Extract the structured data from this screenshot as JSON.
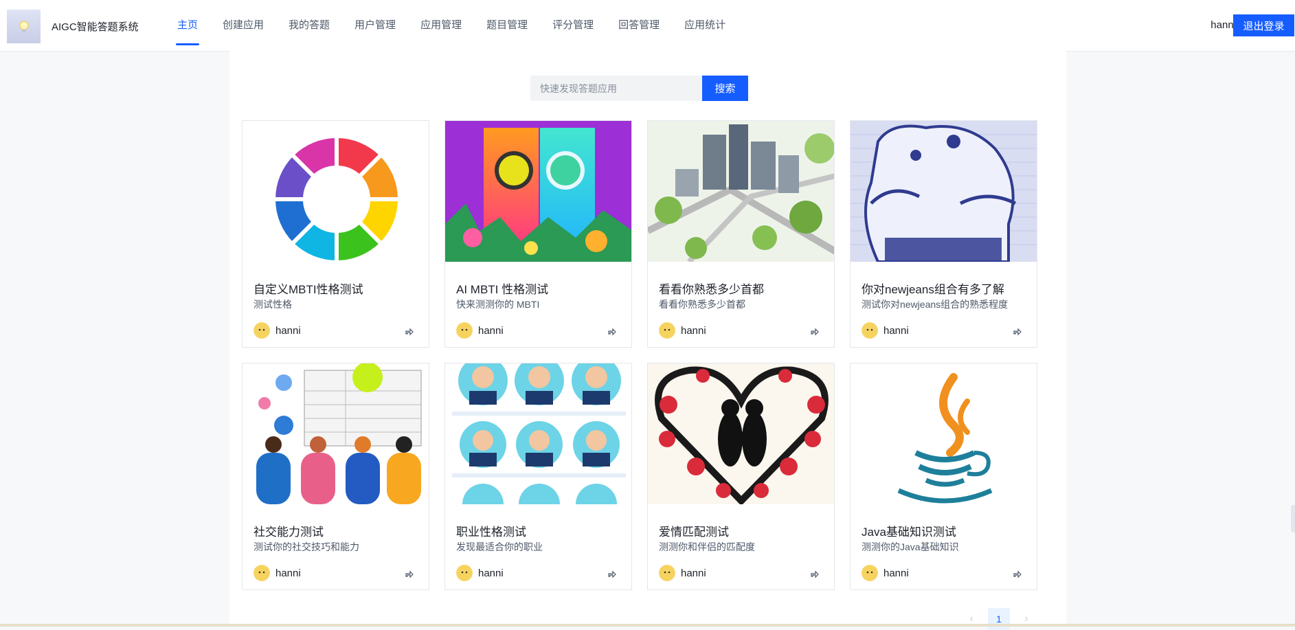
{
  "header": {
    "brand_title": "AIGC智能答题系统",
    "nav": [
      {
        "label": "主页",
        "active": true
      },
      {
        "label": "创建应用",
        "active": false
      },
      {
        "label": "我的答题",
        "active": false
      },
      {
        "label": "用户管理",
        "active": false
      },
      {
        "label": "应用管理",
        "active": false
      },
      {
        "label": "题目管理",
        "active": false
      },
      {
        "label": "评分管理",
        "active": false
      },
      {
        "label": "回答管理",
        "active": false
      },
      {
        "label": "应用统计",
        "active": false
      }
    ],
    "username": "hanni",
    "logout_label": "退出登录"
  },
  "search": {
    "placeholder": "快速发现答题应用",
    "button_label": "搜索"
  },
  "cards": [
    {
      "title": "自定义MBTI性格测试",
      "desc": "测试性格",
      "author": "hanni",
      "cover": "color-wheel"
    },
    {
      "title": "AI MBTI 性格测试",
      "desc": "快来测测你的 MBTI",
      "author": "hanni",
      "cover": "colorful-panels"
    },
    {
      "title": "看看你熟悉多少首都",
      "desc": "看看你熟悉多少首都",
      "author": "hanni",
      "cover": "city-aerial"
    },
    {
      "title": "你对newjeans组合有多了解",
      "desc": "测试你对newjeans组合的熟悉程度",
      "author": "hanni",
      "cover": "bunny-sketch"
    },
    {
      "title": "社交能力测试",
      "desc": "测试你的社交技巧和能力",
      "author": "hanni",
      "cover": "people-chat"
    },
    {
      "title": "职业性格测试",
      "desc": "发现最适合你的职业",
      "author": "hanni",
      "cover": "career-avatars"
    },
    {
      "title": "爱情匹配测试",
      "desc": "测测你和伴侣的匹配度",
      "author": "hanni",
      "cover": "love-heart"
    },
    {
      "title": "Java基础知识测试",
      "desc": "测测你的Java基础知识",
      "author": "hanni",
      "cover": "java-logo"
    }
  ],
  "pagination": {
    "current_page": "1",
    "prev_icon": "chevron-left-icon",
    "next_icon": "chevron-right-icon"
  },
  "colors": {
    "primary": "#165dff",
    "nav_text": "#4e5969",
    "page_bg": "#f7f8fa"
  }
}
